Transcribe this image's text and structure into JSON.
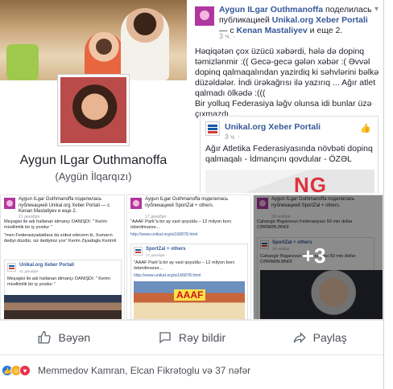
{
  "profile": {
    "name": "Aygun ILgar Outhmanoffa",
    "alt_name": "(Aygün İlqarqızı)"
  },
  "main_post": {
    "header_prefix": "Aygun ILgar Outhmanoffa",
    "header_verb": "поделилась публикацией",
    "shared_page": "Unikal.org Xeber Portali",
    "header_with": "— с",
    "tagged": "Kenan Mastaliyev",
    "and_more": "и еще 2.",
    "time": "3 ч. ·",
    "body": "Həqiqətən çox üzücü xəbərdi, hələ də dopinq təmizlənmir :(( Gecə-gecə gələn xəbər :( Əvvəl dopinq qalmaqalından yazirdiq ki səhvlərini bəlkə düzəldələr. İndi ürəkağrısı ilə yazırıq ... Ağır atlet qalmadı ölkədə :(((\nBir yolluq Federasiya ləğv olunsa idi bunlar üzə çıxmazdı...",
    "card": {
      "page_name": "Unikal.org Xeber Portali",
      "time": "3 ч. ·",
      "title": "Ağır Atletika Federasiyasında növbəti dopinq qalmaqalı - İdmançını qovdular - ÖZƏL",
      "image_text": "NG"
    }
  },
  "thumbs": [
    {
      "header": "Aygun ILgar Outhmanoffa поделилась публикацией Unikal.org Xeber Portali — с Kenan Mastaliyev и еще 2.",
      "date": "21 декабря ·",
      "text1": "Meşəgisi ilə adı hallanan idmançı DANIŞDI: \" Kerim müəllimlik bir iş yoxdur \"",
      "text2": "\"men Federasiyadaklara da sübut edecem ki, Xumarın dediyi düzdür, siz dediyiniz yox\" Kerim Ziyadoglu Kerimli",
      "card_name": "Unikal.org Xeber Portali",
      "card_date": "21 декабря ·",
      "card_text": "Meşəgisi ilə adı hallanan idmançı DANIŞDI: \" Kerim müəllimlik bir iş yoxdur \""
    },
    {
      "header": "Aygun ILgar Outhmanoffa поделилась публикацией SportZal + others.",
      "date": "17 декабря ·",
      "text1": "\"AAAF Park\"a bir ay vaxt qoyuldu – 12 milyon borc ödənilməzsə...",
      "link1": "http://www.unikal.org/w166878.html",
      "card_name": "SportZal + others",
      "card_date": "17 декабря ·",
      "card_text": "\"AAAF Park\"a bir ay vaxt qoyuldu – 12 milyon borc ödənilməzsə...",
      "link2": "http://www.unikal.org/w166878.html",
      "image_text": "AAAF"
    },
    {
      "header": "Aygun ILgar Outhmanoffa поделилась публикацией SportZal + others.",
      "date": "29 ноября ·",
      "text1": "Cahangir Əsgarovun Federasiyası 50 min dollar CƏRİMƏLƏNDİ",
      "card_name": "SportZal + others",
      "card_date": "29 ноября ·",
      "card_text": "Cahangir Əsgarovun Federasiyası 50 min dollar CƏRİMƏLƏNDİ",
      "more_count": "+3"
    }
  ],
  "actions": {
    "like": "Bəyən",
    "comment": "Rəy bildir",
    "share": "Paylaş"
  },
  "reactions": {
    "summary": "Memmedov Kamran, Elcan Fikrətoglu və 37 nəfər"
  },
  "colors": {
    "link": "#365899",
    "brand": "#1877f2"
  }
}
